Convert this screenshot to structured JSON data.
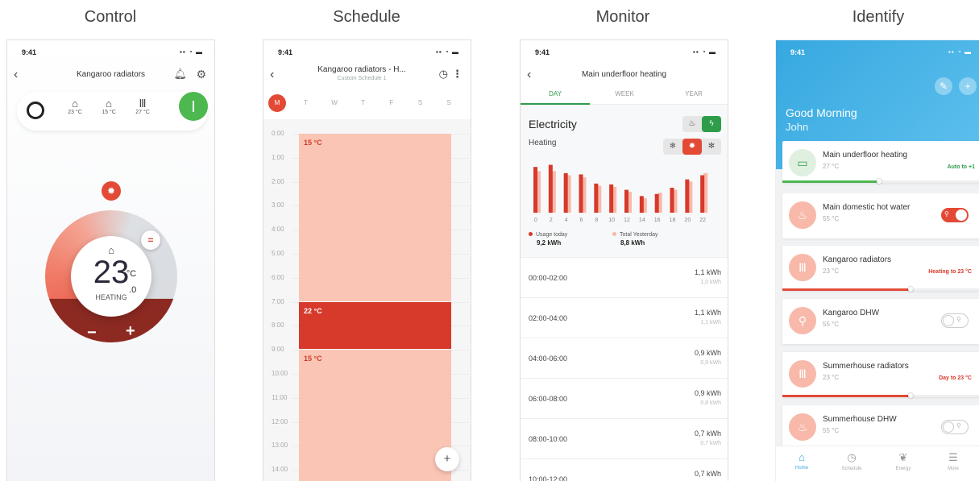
{
  "titles": {
    "control": "Control",
    "schedule": "Schedule",
    "monitor": "Monitor",
    "identify": "Identify"
  },
  "status_time": "9:41",
  "control": {
    "title": "Kangaroo radiators",
    "zones": [
      {
        "temp": "23 °C"
      },
      {
        "temp": "15 °C"
      },
      {
        "temp": "27 °C"
      }
    ],
    "temp_whole": "23",
    "temp_unit": "°C",
    "temp_decimal": ".0",
    "mode_label": "HEATING",
    "minus": "−",
    "plus": "+"
  },
  "schedule": {
    "title": "Kangaroo radiators - H...",
    "subtitle": "Custom Schedule 1",
    "days": [
      "M",
      "T",
      "W",
      "T",
      "F",
      "S",
      "S"
    ],
    "selected_day_index": 0,
    "hours": [
      "0:00",
      "1:00",
      "2:00",
      "3:00",
      "4:00",
      "5:00",
      "6:00",
      "7:00",
      "8:00",
      "9:00",
      "10:00",
      "11:00",
      "12:00",
      "13:00",
      "14:00"
    ],
    "blocks": [
      {
        "label": "15 °C",
        "start": 0,
        "end": 7,
        "color": "#fac5b5",
        "text_color": "#d23a2a"
      },
      {
        "label": "22 °C",
        "start": 7,
        "end": 9,
        "color": "#d7392b",
        "text_color": "#ffffff"
      },
      {
        "label": "15 °C",
        "start": 9,
        "end": 15,
        "color": "#fac5b5",
        "text_color": "#d23a2a"
      }
    ],
    "add": "+"
  },
  "monitor": {
    "title": "Main underfloor heating",
    "tabs": [
      "DAY",
      "WEEK",
      "YEAR"
    ],
    "heading": "Electricity",
    "subheading": "Heating",
    "legend": [
      {
        "label": "Usage today",
        "value": "9,2 kWh",
        "color": "#d7392b"
      },
      {
        "label": "Total Yesterday",
        "value": "8,8 kWh",
        "color": "#f8b9aa"
      }
    ],
    "rows": [
      {
        "time": "00:00-02:00",
        "value": "1,1 kWh",
        "sub": "1,0 kWh"
      },
      {
        "time": "02:00-04:00",
        "value": "1,1 kWh",
        "sub": "1,1 kWh"
      },
      {
        "time": "04:00-06:00",
        "value": "0,9 kWh",
        "sub": "0,9 kWh"
      },
      {
        "time": "06:00-08:00",
        "value": "0,9 kWh",
        "sub": "0,8 kWh"
      },
      {
        "time": "08:00-10:00",
        "value": "0,7 kWh",
        "sub": "0,7 kWh"
      },
      {
        "time": "10:00-12:00",
        "value": "0,7 kWh",
        "sub": ""
      }
    ]
  },
  "chart_data": {
    "type": "bar",
    "categories": [
      "0",
      "2",
      "4",
      "6",
      "8",
      "10",
      "12",
      "14",
      "16",
      "18",
      "20",
      "22"
    ],
    "series": [
      {
        "name": "Usage today",
        "values": [
          1.1,
          1.15,
          0.95,
          0.92,
          0.7,
          0.68,
          0.55,
          0.4,
          0.45,
          0.6,
          0.8,
          0.9
        ],
        "color": "#d7392b"
      },
      {
        "name": "Total Yesterday",
        "values": [
          1.0,
          1.0,
          0.9,
          0.85,
          0.65,
          0.62,
          0.5,
          0.35,
          0.48,
          0.55,
          0.75,
          0.95
        ],
        "color": "#f8b9aa"
      }
    ],
    "ylim": [
      0,
      1.2
    ]
  },
  "identify": {
    "greeting": "Good Morning",
    "name": "John",
    "devices": [
      {
        "name": "Main underfloor heating",
        "temp": "27 °C",
        "status": "Auto to +1",
        "status_color": "#2e9d4a",
        "kind": "bar",
        "progress": 0.48,
        "bar_color": "#4cb84f",
        "icon": "underfloor-icon",
        "glyph": "▭",
        "icon_bg": "#dff0e0"
      },
      {
        "name": "Main domestic hot water",
        "temp": "55 °C",
        "status": "",
        "kind": "toggle",
        "on": true,
        "icon": "hot-water-icon",
        "glyph": "♨",
        "icon_bg": "#f8b9aa"
      },
      {
        "name": "Kangaroo radiators",
        "temp": "23 °C",
        "status": "Heating to 23 °C",
        "status_color": "#d7392b",
        "kind": "bar",
        "progress": 0.65,
        "bar_color": "#e24a36",
        "icon": "radiator-icon",
        "glyph": "Ⅲ",
        "icon_bg": "#f8b9aa"
      },
      {
        "name": "Kangaroo DHW",
        "temp": "55 °C",
        "status": "",
        "kind": "toggle",
        "on": false,
        "icon": "tap-icon",
        "glyph": "⚲",
        "icon_bg": "#f8b9aa"
      },
      {
        "name": "Summerhouse radiators",
        "temp": "23 °C",
        "status": "Day to 23 °C",
        "status_color": "#d7392b",
        "kind": "bar",
        "progress": 0.65,
        "bar_color": "#e24a36",
        "icon": "radiator-icon",
        "glyph": "Ⅲ",
        "icon_bg": "#f8b9aa"
      },
      {
        "name": "Summerhouse DHW",
        "temp": "55 °C",
        "status": "",
        "kind": "toggle",
        "on": false,
        "icon": "heater-icon",
        "glyph": "♨",
        "icon_bg": "#f8b9aa"
      }
    ],
    "nav": [
      "Home",
      "Schedule",
      "Energy",
      "More"
    ]
  }
}
